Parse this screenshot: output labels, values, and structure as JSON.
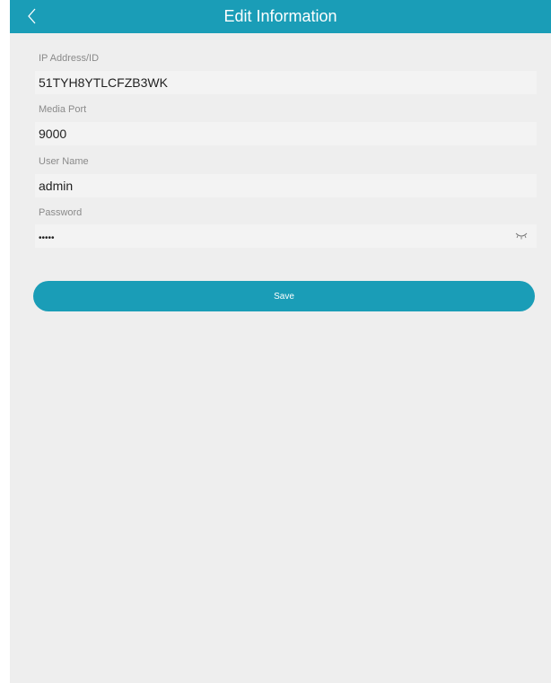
{
  "header": {
    "title": "Edit Information",
    "back_icon": "chevron-left-icon"
  },
  "form": {
    "ip": {
      "label": "IP Address/ID",
      "value": "51TYH8YTLCFZB3WK"
    },
    "port": {
      "label": "Media Port",
      "value": "9000"
    },
    "username": {
      "label": "User Name",
      "value": "admin"
    },
    "password": {
      "label": "Password",
      "value": "•••••",
      "toggle_icon": "eye-closed-icon"
    }
  },
  "actions": {
    "save_label": "Save"
  },
  "colors": {
    "accent": "#1a9db7",
    "background": "#eeeeee",
    "field_bg": "#f3f3f3",
    "label": "#8a8a8a"
  }
}
